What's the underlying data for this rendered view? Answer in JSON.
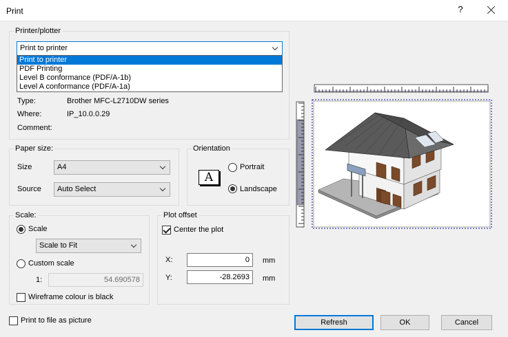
{
  "window": {
    "title": "Print",
    "help": "?"
  },
  "printer": {
    "group_label": "Printer/plotter",
    "selected": "Print to printer",
    "options": [
      "Print to printer",
      "PDF Printing",
      "Level B conformance (PDF/A-1b)",
      "Level A conformance (PDF/A-1a)"
    ],
    "type_label": "Type:",
    "type_value": "Brother MFC-L2710DW series",
    "where_label": "Where:",
    "where_value": "IP_10.0.0.29",
    "comment_label": "Comment:"
  },
  "paper": {
    "group_label": "Paper size:",
    "size_label": "Size",
    "size_value": "A4",
    "source_label": "Source",
    "source_value": "Auto Select"
  },
  "orientation": {
    "group_label": "Orientation",
    "icon_glyph": "A",
    "portrait_label": "Portrait",
    "landscape_label": "Landscape",
    "selected": "landscape"
  },
  "scale": {
    "group_label": "Scale:",
    "scale_label": "Scale",
    "scale_mode": "Scale to Fit",
    "custom_label": "Custom scale",
    "ratio_prefix": "1:",
    "ratio_value": "54.690578",
    "wireframe_label": "Wireframe colour is black",
    "selected": "scale"
  },
  "offset": {
    "group_label": "Plot offset",
    "center_label": "Center the plot",
    "x_label": "X:",
    "x_value": "0",
    "x_unit": "mm",
    "y_label": "Y:",
    "y_value": "-28.2693",
    "y_unit": "mm"
  },
  "footer": {
    "print_to_file_label": "Print to file as picture",
    "refresh_label": "Refresh",
    "ok_label": "OK",
    "cancel_label": "Cancel"
  },
  "colors": {
    "accent": "#0078d7",
    "preview_border": "#0a0a8a"
  },
  "preview": {
    "icon": "house-3d-preview"
  }
}
